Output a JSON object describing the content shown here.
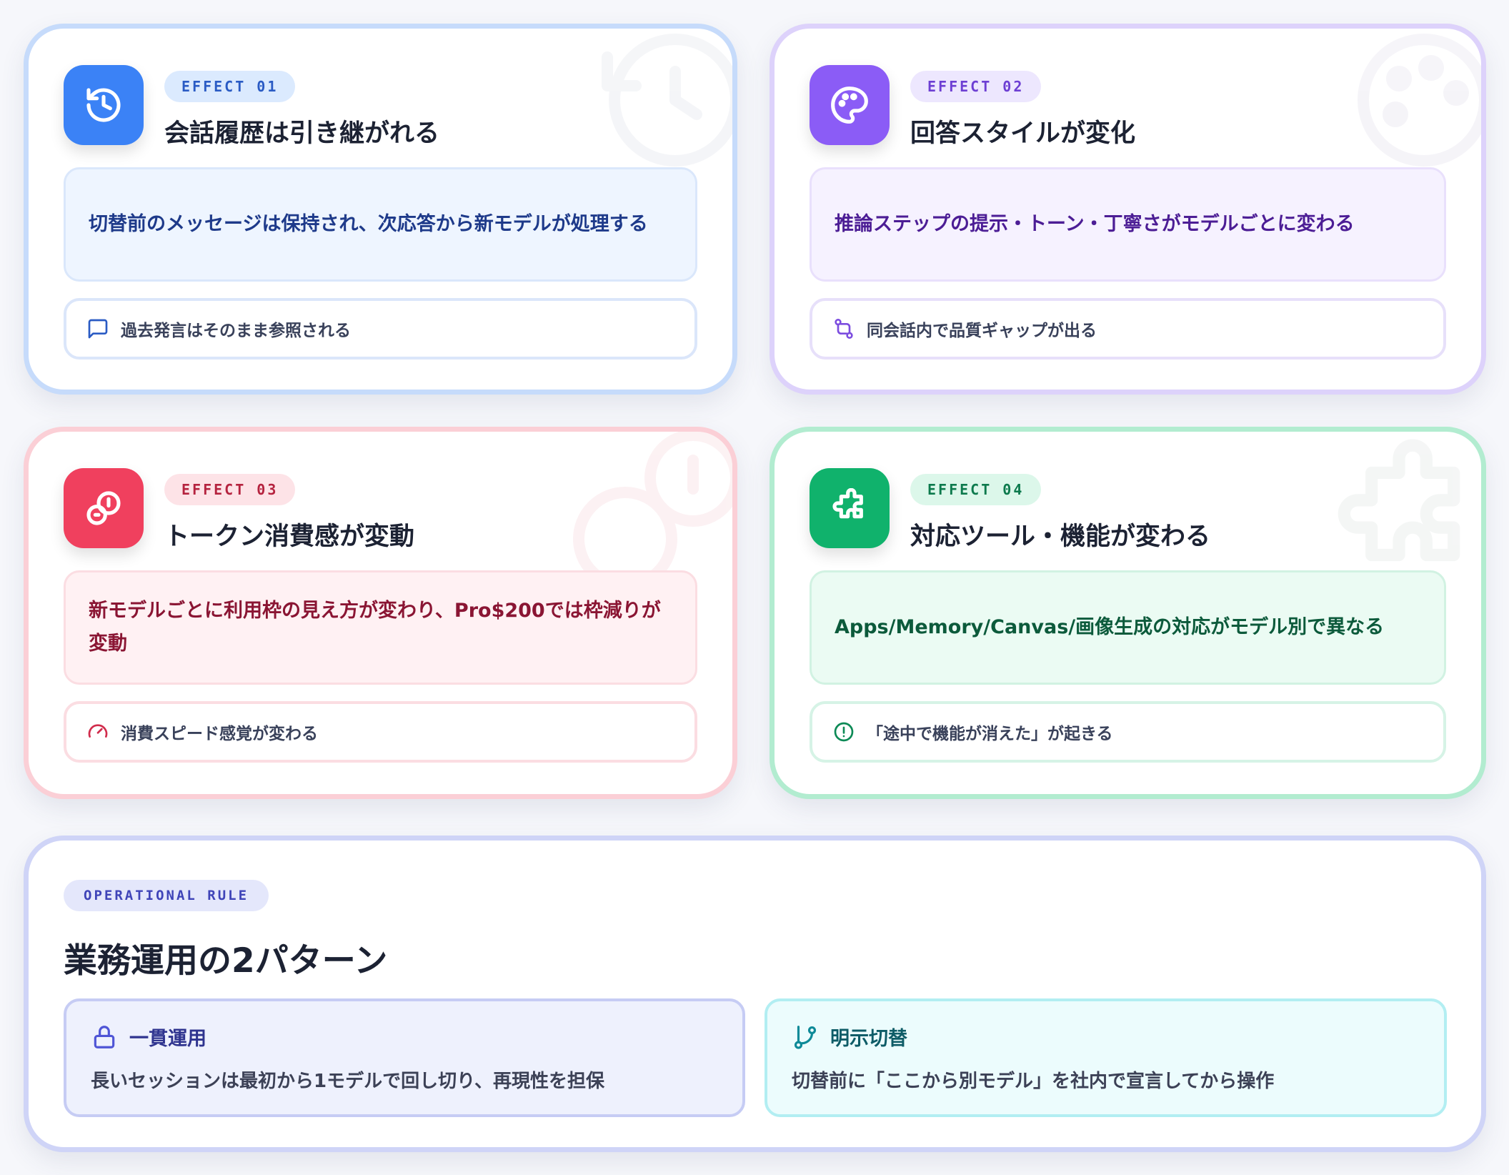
{
  "cards": [
    {
      "badge": "EFFECT 01",
      "title": "会話履歴は引き継がれる",
      "description": "切替前のメッセージは保持され、次応答から新モデルが処理する",
      "note": "過去発言はそのまま参照される",
      "icon": "history-icon",
      "note_icon": "chat-bubble-icon",
      "accent": "#3b82f6"
    },
    {
      "badge": "EFFECT 02",
      "title": "回答スタイルが変化",
      "description": "推論ステップの提示・トーン・丁寧さがモデルごとに変わる",
      "note": "同会話内で品質ギャップが出る",
      "icon": "palette-icon",
      "note_icon": "git-compare-icon",
      "accent": "#8b5cf6"
    },
    {
      "badge": "EFFECT 03",
      "title": "トークン消費感が変動",
      "description": "新モデルごとに利用枠の見え方が変わり、Pro$200では枠減りが変動",
      "note": "消費スピード感覚が変わる",
      "icon": "coins-icon",
      "note_icon": "gauge-icon",
      "accent": "#f0405e"
    },
    {
      "badge": "EFFECT 04",
      "title": "対応ツール・機能が変わる",
      "description": "Apps/Memory/Canvas/画像生成の対応がモデル別で異なる",
      "note": "「途中で機能が消えた」が起きる",
      "icon": "puzzle-icon",
      "note_icon": "alert-circle-icon",
      "accent": "#10b26c"
    }
  ],
  "operational": {
    "badge": "OPERATIONAL RULE",
    "title": "業務運用の2パターン",
    "patterns": [
      {
        "label": "一貫運用",
        "text": "長いセッションは最初から1モデルで回し切り、再現性を担保",
        "icon": "lock-icon"
      },
      {
        "label": "明示切替",
        "text": "切替前に「ここから別モデル」を社内で宣言してから操作",
        "icon": "git-branch-icon"
      }
    ]
  }
}
